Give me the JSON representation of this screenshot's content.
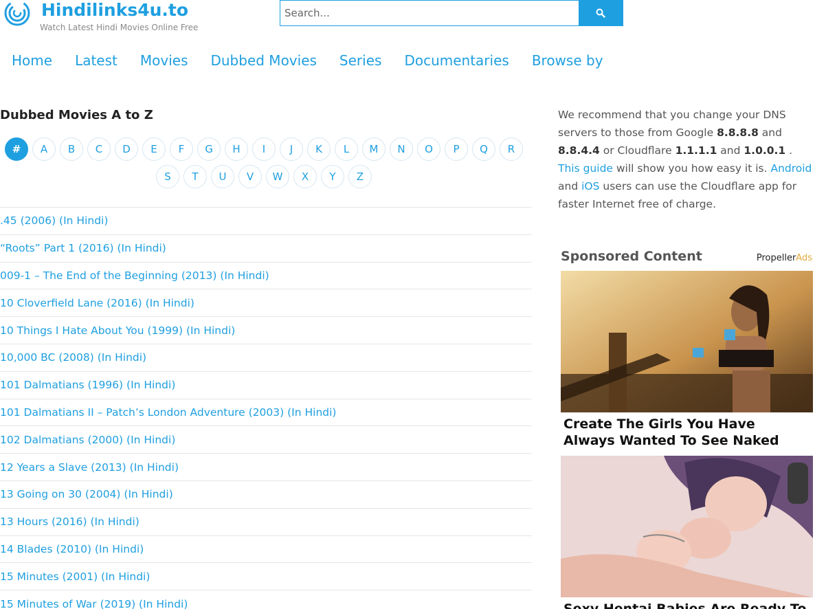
{
  "header": {
    "title": "Hindilinks4u.to",
    "tagline": "Watch Latest Hindi Movies Online Free",
    "search_placeholder": "Search..."
  },
  "nav": [
    "Home",
    "Latest",
    "Movies",
    "Dubbed Movies",
    "Series",
    "Documentaries",
    "Browse by"
  ],
  "main": {
    "section_title": "Dubbed Movies A to Z",
    "az_row1": [
      "#",
      "A",
      "B",
      "C",
      "D",
      "E",
      "F",
      "G",
      "H",
      "I",
      "J",
      "K",
      "L",
      "M",
      "N",
      "O",
      "P",
      "Q",
      "R"
    ],
    "az_row2": [
      "S",
      "T",
      "U",
      "V",
      "W",
      "X",
      "Y",
      "Z"
    ],
    "active_letter": "#",
    "movies": [
      ".45 (2006) (In Hindi)",
      "“Roots” Part 1 (2016) (In Hindi)",
      "009-1 – The End of the Beginning (2013) (In Hindi)",
      "10 Cloverfield Lane (2016) (In Hindi)",
      "10 Things I Hate About You (1999) (In Hindi)",
      "10,000 BC (2008) (In Hindi)",
      "101 Dalmatians (1996) (In Hindi)",
      "101 Dalmatians II – Patch’s London Adventure (2003) (In Hindi)",
      "102 Dalmatians (2000) (In Hindi)",
      "12 Years a Slave (2013) (In Hindi)",
      "13 Going on 30 (2004) (In Hindi)",
      "13 Hours (2016) (In Hindi)",
      "14 Blades (2010) (In Hindi)",
      "15 Minutes (2001) (In Hindi)",
      "15 Minutes of War (2019) (In Hindi)"
    ]
  },
  "sidebar": {
    "dns": {
      "t1": "We recommend that you change your DNS servers to those from Google ",
      "ip1": "8.8.8.8",
      "t2": " and ",
      "ip2": "8.8.4.4",
      "t3": " or Cloudflare ",
      "ip3": "1.1.1.1",
      "t4": " and ",
      "ip4": "1.0.0.1",
      "t5": " . ",
      "guide": "This guide",
      "t6": " will show you how easy it is. ",
      "android": "Android",
      "t7": " and ",
      "ios": "iOS",
      "t8": " users can use the Cloudflare app for faster Internet free of charge."
    },
    "sponsored_title": "Sponsored Content",
    "propeller": "Propeller",
    "propeller_ads": "Ads",
    "ads": [
      {
        "caption": "Create The Girls You Have Always Wanted To See Naked"
      },
      {
        "caption": "Sexy Hentai Babies Are Ready To"
      }
    ]
  },
  "colors": {
    "accent": "#1e9fe0",
    "text": "#555555"
  }
}
